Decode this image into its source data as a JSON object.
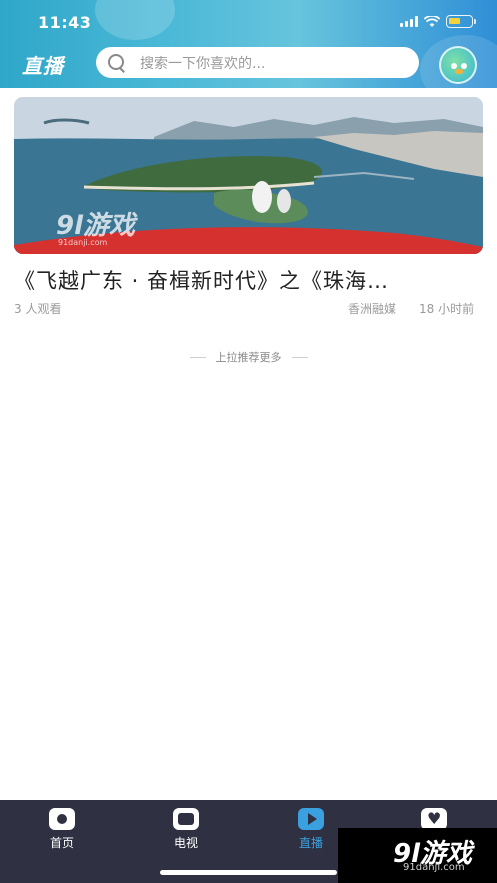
{
  "status_bar": {
    "time": "11:43"
  },
  "header": {
    "logo": "直播",
    "search_placeholder": "搜索一下你喜欢的..."
  },
  "feed": {
    "items": [
      {
        "title": "《飞越广东 · 奋楫新时代》之《珠海…",
        "views": "3 人观看",
        "source": "香洲融媒",
        "time": "18 小时前",
        "thumbnail_watermark": "9l游戏",
        "thumbnail_watermark_url": "91danji.com"
      }
    ],
    "load_more": "上拉推荐更多"
  },
  "tabbar": {
    "tabs": [
      {
        "label": "首页",
        "icon": "home-icon",
        "active": false
      },
      {
        "label": "电视",
        "icon": "tv-icon",
        "active": false
      },
      {
        "label": "直播",
        "icon": "play-icon",
        "active": true
      },
      {
        "label": "",
        "icon": "heart-icon",
        "active": false
      }
    ]
  },
  "watermark": {
    "brand": "9l游戏",
    "url": "91danji.com"
  },
  "colors": {
    "accent": "#3aa0e0",
    "tabbar_bg": "#2f3142",
    "header_start": "#2fa7c9",
    "header_end": "#2f8fd6"
  }
}
